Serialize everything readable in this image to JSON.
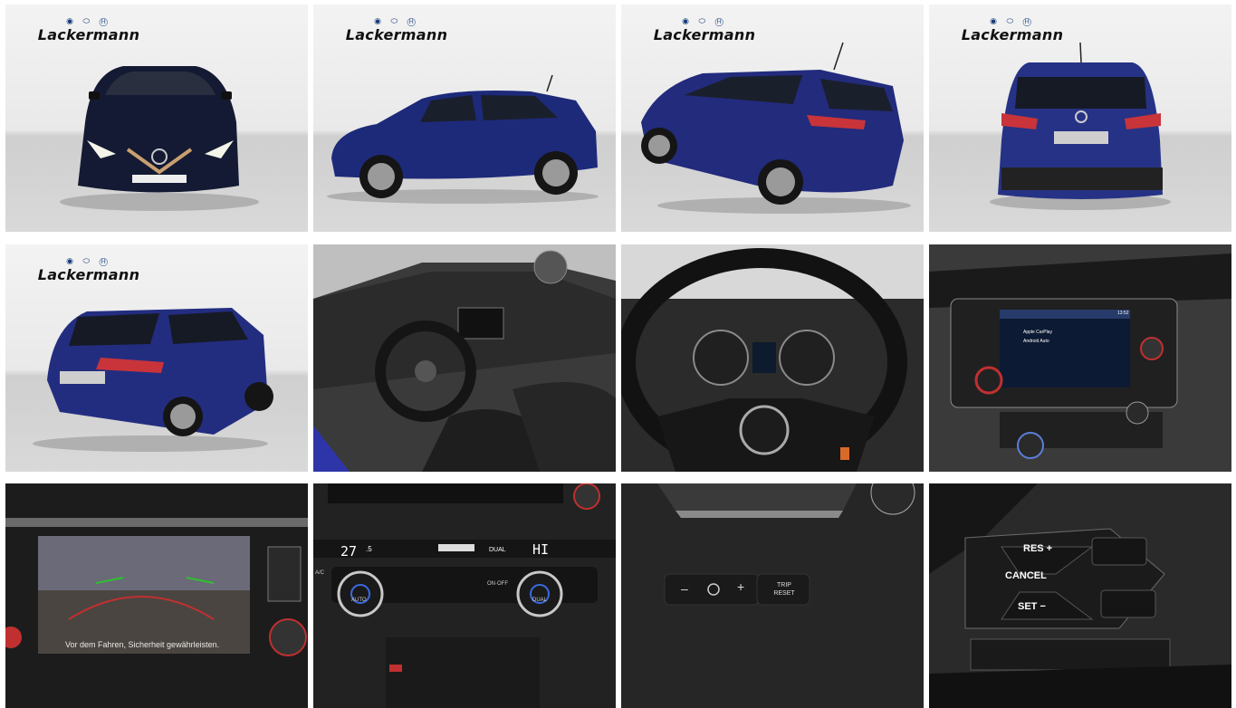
{
  "gallery": {
    "brand": {
      "wordmark": "Lackermann",
      "logos": "◉ ⬭ Ⓗ"
    },
    "infotainment": {
      "menu_items": [
        "Apple CarPlay",
        "Android Auto"
      ],
      "time": "13:52"
    },
    "rear_camera": {
      "warning": "Vor dem Fahren, Sicherheit gewährleisten."
    },
    "climate": {
      "left_temp": "27",
      "left_unit": ".5",
      "right_temp": "HI",
      "dual_label": "DUAL",
      "auto_label": "AUTO",
      "onoff_label": "ON·OFF",
      "ac_label": "A/C"
    },
    "dash_buttons": {
      "trip_reset": "TRIP RESET",
      "minus": "–",
      "plus": "+"
    },
    "wheel_controls": {
      "res_plus": "RES +",
      "cancel": "CANCEL",
      "set_minus": "SET −"
    }
  }
}
